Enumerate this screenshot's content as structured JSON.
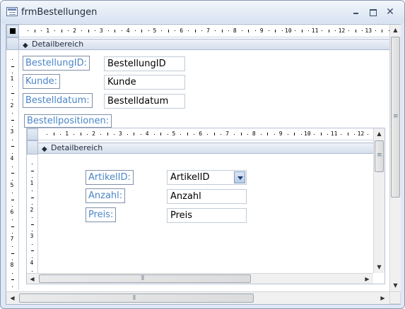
{
  "window": {
    "title": "frmBestellungen"
  },
  "main": {
    "section_label": "Detailbereich",
    "ruler_top": [
      "1",
      "2",
      "3",
      "4",
      "5",
      "6",
      "7",
      "8",
      "9",
      "10",
      "11",
      "12",
      "13"
    ],
    "ruler_left": [
      "1",
      "2",
      "3",
      "4",
      "5",
      "6",
      "7",
      "8"
    ],
    "fields": [
      {
        "label": "BestellungID:",
        "value": "BestellungID"
      },
      {
        "label": "Kunde:",
        "value": "Kunde"
      },
      {
        "label": "Bestelldatum:",
        "value": "Bestelldatum"
      }
    ],
    "subform_label": "Bestellpositionen:"
  },
  "subform": {
    "section_label": "Detailbereich",
    "ruler_top": [
      "1",
      "2",
      "3",
      "4",
      "5",
      "6",
      "7",
      "8",
      "9",
      "10",
      "11",
      "12"
    ],
    "ruler_left": [
      "1",
      "2",
      "3",
      "4"
    ],
    "fields": [
      {
        "label": "ArtikelID:",
        "value": "ArtikelID",
        "dropdown": true
      },
      {
        "label": "Anzahl:",
        "value": "Anzahl"
      },
      {
        "label": "Preis:",
        "value": "Preis"
      }
    ]
  },
  "icons": {
    "window_icon": "form-icon",
    "minimize": "minimize-icon",
    "maximize": "maximize-icon",
    "close": "close-icon",
    "section_toggle": "collapse-arrow-icon",
    "dropdown": "chevron-down-icon"
  }
}
